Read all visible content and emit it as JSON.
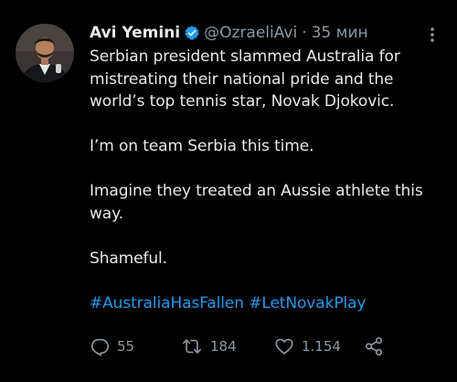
{
  "tweet": {
    "author": {
      "display_name": "Avi Yemini",
      "handle": "@OzraeliAvi",
      "verified": true
    },
    "separator": "·",
    "timestamp": "35 мин",
    "lines": [
      "Serbian president slammed Australia for",
      "mistreating their national pride and the",
      "world’s top tennis star, Novak Djokovic.",
      "I’m on team Serbia this time.",
      "Imagine they treated an Aussie athlete this",
      "way.",
      "Shameful."
    ],
    "hashtags": [
      "#AustraliaHasFallen",
      "#LetNovakPlay"
    ],
    "actions": {
      "replies": "55",
      "retweets": "184",
      "likes": "1.154"
    }
  },
  "colors": {
    "background": "#000000",
    "text": "#e7e9ea",
    "secondary": "#8b98a5",
    "accent": "#1d9bf0"
  },
  "icons": [
    "verified-badge-icon",
    "more-options-icon",
    "reply-icon",
    "retweet-icon",
    "like-icon",
    "share-icon"
  ]
}
